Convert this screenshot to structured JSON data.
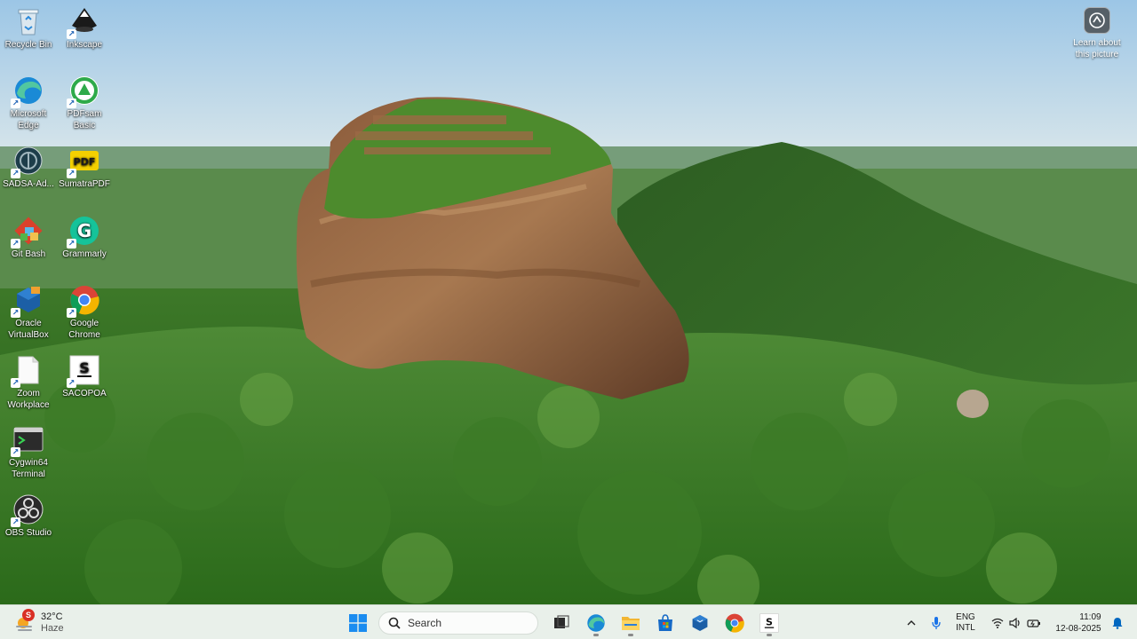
{
  "desktop": {
    "icons": [
      {
        "label": "Recycle Bin",
        "icon": "recycle-bin-icon",
        "shortcut": false
      },
      {
        "label": "Inkscape",
        "icon": "inkscape-icon",
        "shortcut": true
      },
      {
        "label": "Microsoft\nEdge",
        "icon": "edge-icon",
        "shortcut": true
      },
      {
        "label": "PDFsam Basic",
        "icon": "pdfsam-icon",
        "shortcut": true
      },
      {
        "label": "SADSA-Ad...",
        "icon": "sadsa-icon",
        "shortcut": true
      },
      {
        "label": "SumatraPDF",
        "icon": "sumatrapdf-icon",
        "shortcut": true
      },
      {
        "label": "Git Bash",
        "icon": "git-bash-icon",
        "shortcut": true
      },
      {
        "label": "Grammarly",
        "icon": "grammarly-icon",
        "shortcut": true
      },
      {
        "label": "Oracle\nVirtualBox",
        "icon": "virtualbox-icon",
        "shortcut": true
      },
      {
        "label": "Google\nChrome",
        "icon": "chrome-icon",
        "shortcut": true
      },
      {
        "label": "Zoom\nWorkplace",
        "icon": "zoom-file-icon",
        "shortcut": true
      },
      {
        "label": "SACOPOA",
        "icon": "sacopoa-icon",
        "shortcut": true
      },
      {
        "label": "Cygwin64\nTerminal",
        "icon": "cygwin-terminal-icon",
        "shortcut": true
      },
      {
        "label": "OBS Studio",
        "icon": "obs-studio-icon",
        "shortcut": true
      }
    ],
    "learn_about": {
      "label": "Learn about\nthis picture",
      "icon": "camera-icon"
    }
  },
  "taskbar": {
    "weather": {
      "temp": "32°C",
      "condition": "Haze",
      "badge": "S",
      "icon": "haze-weather-icon"
    },
    "search": {
      "placeholder": "Search"
    },
    "apps": [
      {
        "name": "task-view",
        "icon": "task-view-icon",
        "running": false
      },
      {
        "name": "edge",
        "icon": "edge-icon",
        "running": true
      },
      {
        "name": "file-explorer",
        "icon": "folder-icon",
        "running": true
      },
      {
        "name": "store",
        "icon": "store-icon",
        "running": false
      },
      {
        "name": "virtualbox",
        "icon": "virtualbox-icon",
        "running": false
      },
      {
        "name": "chrome",
        "icon": "chrome-icon",
        "running": false
      },
      {
        "name": "sacopoa",
        "icon": "sacopoa-icon",
        "running": true
      }
    ],
    "tray": {
      "lang_top": "ENG",
      "lang_bottom": "INTL",
      "time": "11:09",
      "date": "12-08-2025"
    }
  },
  "colors": {
    "taskbar_bg": "#e9f0ea",
    "accent": "#0067c0"
  }
}
